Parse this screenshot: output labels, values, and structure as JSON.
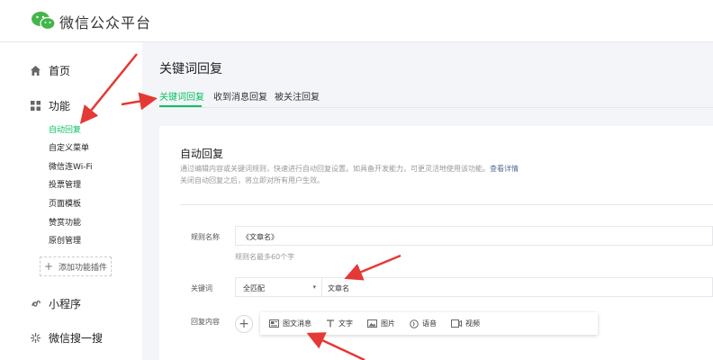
{
  "app": {
    "title": "微信公众平台",
    "logo_icon": "wechat-logo-icon"
  },
  "sidebar": {
    "home": "首页",
    "features": "功能",
    "sub_items": [
      "自动回复",
      "自定义菜单",
      "微信连Wi-Fi",
      "投票管理",
      "页面模板",
      "赞赏功能",
      "原创管理"
    ],
    "add_plugin": "添加功能插件",
    "mini_program": "小程序",
    "search": "微信搜一搜",
    "active_item": "自动回复"
  },
  "page": {
    "title": "关键词回复",
    "tabs": [
      "关键词回复",
      "收到消息回复",
      "被关注回复"
    ],
    "active_tab": "关键词回复"
  },
  "card": {
    "title": "自动回复",
    "desc_line1": "通过编辑内容或关键词规则，快速进行自动回复设置。如具备开发能力，可更灵活地使用该功能。",
    "desc_link": "查看详情",
    "desc_line2": "关闭自动回复之后，将立即对所有用户生效。",
    "rule_label": "规则名称",
    "rule_value": "《文章名》",
    "rule_hint": "规则名最多60个字",
    "keyword_label": "关键词",
    "match_option": "全匹配",
    "keyword_value": "文章名",
    "reply_label": "回复内容",
    "reply_types": [
      "图文消息",
      "文字",
      "图片",
      "语音",
      "视频"
    ]
  },
  "colors": {
    "accent": "#07c160",
    "arrow": "#e53935",
    "link": "#576b95"
  }
}
